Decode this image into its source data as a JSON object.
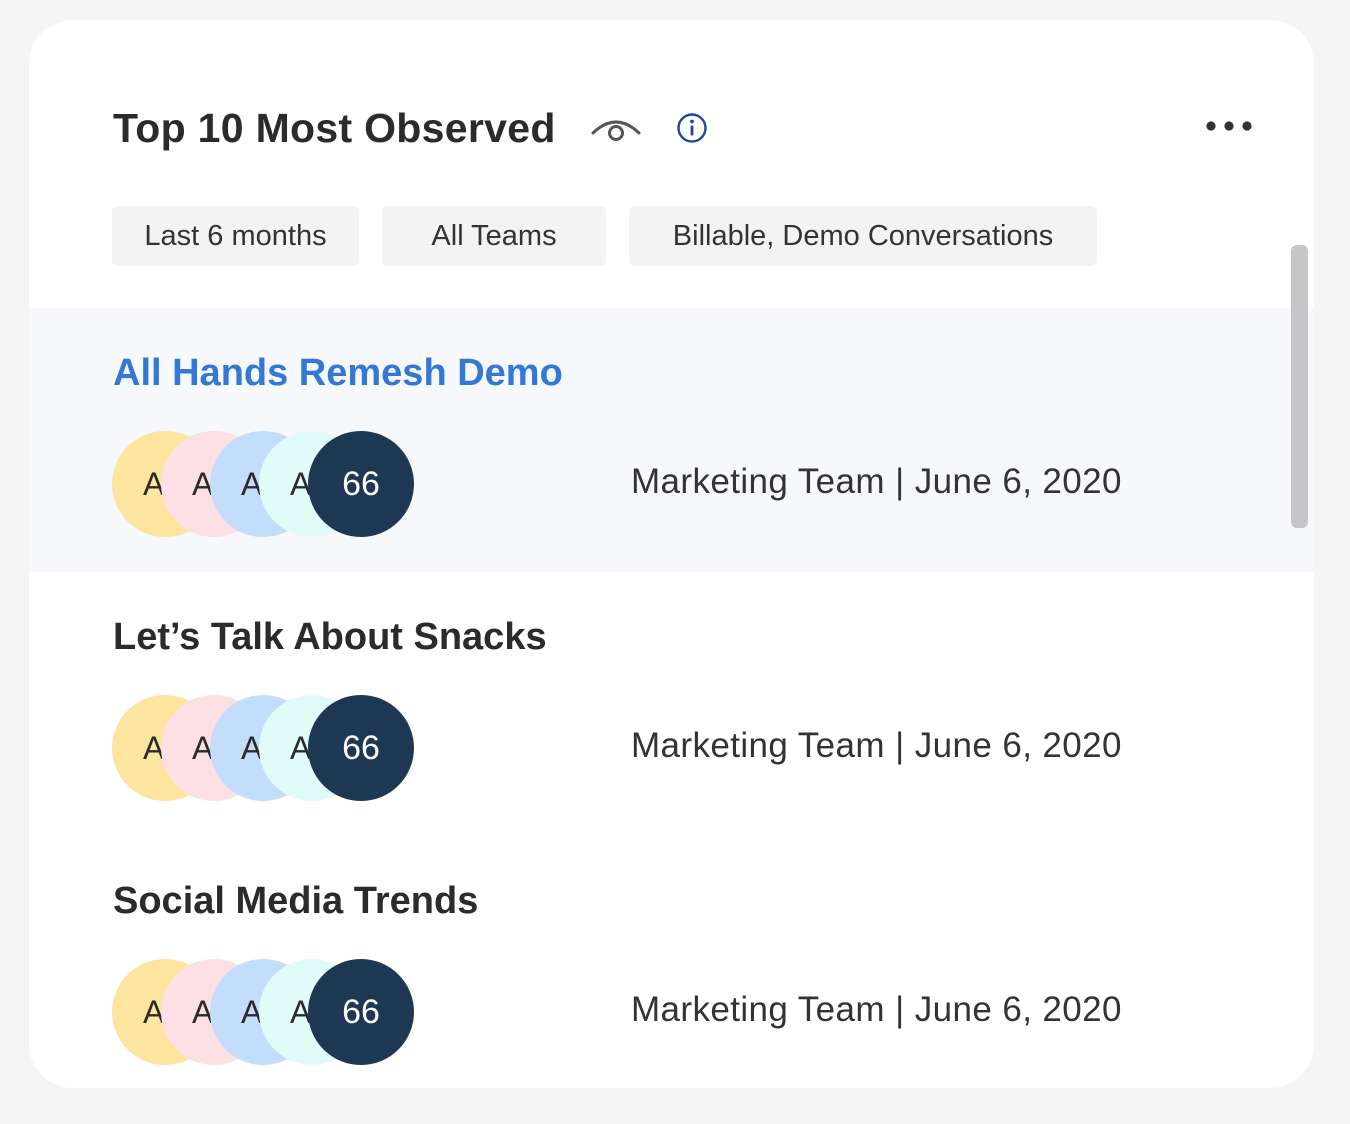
{
  "widget": {
    "title": "Top 10 Most Observed",
    "colors": {
      "accent": "#3478d6",
      "info_icon": "#1b46a8",
      "count_avatar": "#1e3753",
      "active_row_bg": "#f6f8fc"
    },
    "icons": {
      "eye": "eye-icon",
      "info": "info-icon",
      "more": "more-horizontal-icon"
    }
  },
  "filters": [
    {
      "label": "Last 6 months"
    },
    {
      "label": "All Teams"
    },
    {
      "label": "Billable, Demo Conversations"
    }
  ],
  "conversations": [
    {
      "title": "All Hands Remesh Demo",
      "active": true,
      "avatars": [
        "A",
        "A",
        "A",
        "A"
      ],
      "count": "66",
      "team": "Marketing Team",
      "separator": "|",
      "date": "June 6, 2020"
    },
    {
      "title": "Let’s Talk About Snacks",
      "active": false,
      "avatars": [
        "A",
        "A",
        "A",
        "A"
      ],
      "count": "66",
      "team": "Marketing Team",
      "separator": "|",
      "date": "June 6, 2020"
    },
    {
      "title": "Social Media Trends",
      "active": false,
      "avatars": [
        "A",
        "A",
        "A",
        "A"
      ],
      "count": "66",
      "team": "Marketing Team",
      "separator": "|",
      "date": "June 6, 2020"
    }
  ]
}
